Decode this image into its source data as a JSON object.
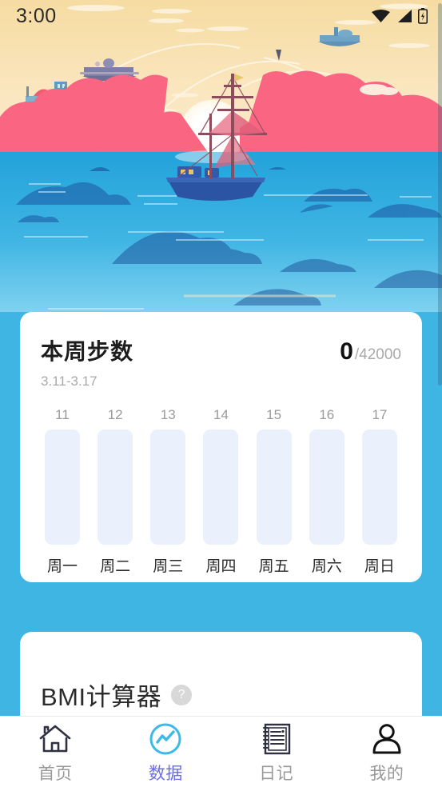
{
  "statusbar": {
    "time": "3:00",
    "icons": [
      "wifi-icon",
      "cellular-signal-icon",
      "battery-charging-icon"
    ]
  },
  "hero": {
    "name": "sunset-sea-sailboat-illustration",
    "colors": {
      "sky_top": "#F7DFA8",
      "sky_bottom": "#FBE6BE",
      "sun": "#FFFFFF",
      "clouds_pink": "#F9637E",
      "sea_top": "#2BA8DE",
      "sea_bottom": "#7FD1EF",
      "ship_hull": "#2A55A8"
    }
  },
  "steps_card": {
    "title": "本周步数",
    "value": "0",
    "goal": "/42000",
    "range": "3.11-3.17"
  },
  "chart_data": {
    "type": "bar",
    "title": "本周步数",
    "categories": [
      "周一",
      "周二",
      "周三",
      "周四",
      "周五",
      "周六",
      "周日"
    ],
    "tick_labels": [
      "11",
      "12",
      "13",
      "14",
      "15",
      "16",
      "17"
    ],
    "values": [
      0,
      0,
      0,
      0,
      0,
      0,
      0
    ],
    "ylim": [
      0,
      6000
    ],
    "goal_total": 42000,
    "current_total": 0,
    "xlabel": "",
    "ylabel": "",
    "grid": false,
    "legend": null,
    "bar_track_color": "#EBF1FC",
    "bar_fill_color": "#4FC0EC"
  },
  "bmi_card": {
    "title": "BMI计算器",
    "help_glyph": "?"
  },
  "tabbar": {
    "items": [
      {
        "label": "首页",
        "icon": "home-icon",
        "active": false
      },
      {
        "label": "数据",
        "icon": "chart-circle-icon",
        "active": true
      },
      {
        "label": "日记",
        "icon": "notebook-icon",
        "active": false
      },
      {
        "label": "我的",
        "icon": "person-icon",
        "active": false
      }
    ],
    "active_color": "#6C6CE8",
    "active_icon_color": "#3BB9E8",
    "inactive_color": "#999999"
  },
  "theme": {
    "page_background": "#3FB5E3",
    "card_background": "#FFFFFF"
  }
}
